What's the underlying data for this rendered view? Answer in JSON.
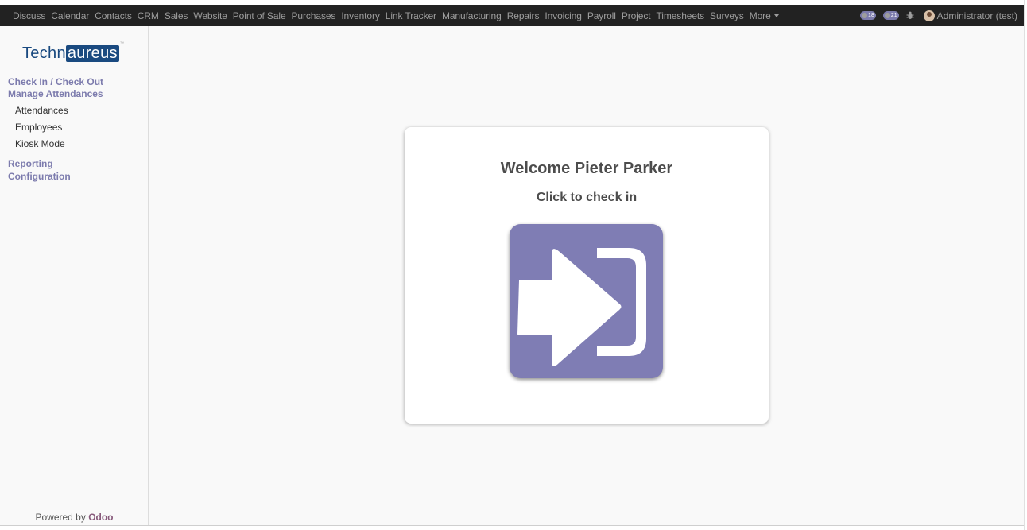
{
  "topbar": {
    "menu": [
      "Discuss",
      "Calendar",
      "Contacts",
      "CRM",
      "Sales",
      "Website",
      "Point of Sale",
      "Purchases",
      "Inventory",
      "Link Tracker",
      "Manufacturing",
      "Repairs",
      "Invoicing",
      "Payroll",
      "Project",
      "Timesheets",
      "Surveys"
    ],
    "more_label": "More",
    "activity_count": "18",
    "messages_count": "21",
    "user_name": "Administrator (test)"
  },
  "sidebar": {
    "logo_plain": "Techn",
    "logo_boxed": "aureus",
    "logo_tm": "™",
    "sections": [
      {
        "label": "Check In / Check Out"
      },
      {
        "label": "Manage Attendances"
      }
    ],
    "manage_items": [
      "Attendances",
      "Employees",
      "Kiosk Mode"
    ],
    "reporting": "Reporting",
    "configuration": "Configuration",
    "powered_by": "Powered by",
    "powered_brand": "Odoo"
  },
  "card": {
    "welcome": "Welcome Pieter Parker",
    "hint": "Click to check in",
    "button_icon": "sign-in-icon"
  },
  "colors": {
    "navbar": "#222222",
    "accent": "#7c7bad",
    "button": "#7f7db4",
    "logo": "#1a4a80",
    "odoo": "#875a7b"
  }
}
